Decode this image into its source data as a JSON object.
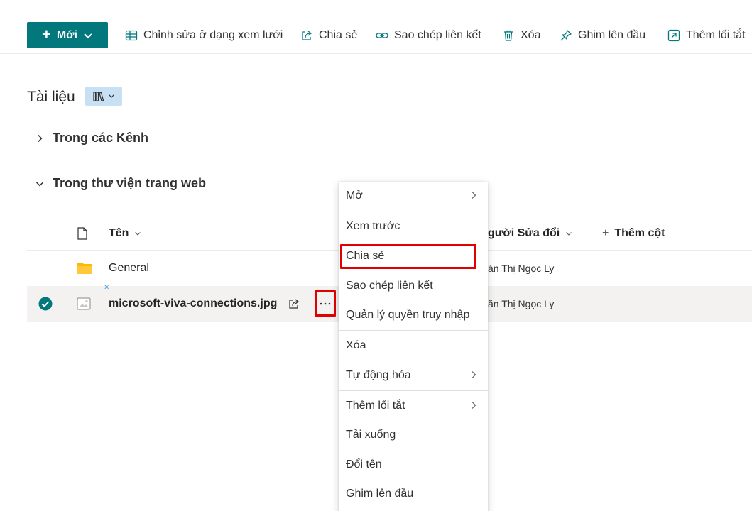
{
  "toolbar": {
    "new_label": "Mới",
    "grid_edit_label": "Chỉnh sửa ở dạng xem lưới",
    "share_label": "Chia sẻ",
    "copy_link_label": "Sao chép liên kết",
    "delete_label": "Xóa",
    "pin_label": "Ghim lên đầu",
    "shortcut_label": "Thêm lối tắt"
  },
  "library": {
    "title": "Tài liệu",
    "groups": [
      {
        "label": "Trong các Kênh",
        "expanded": false
      },
      {
        "label": "Trong thư viện trang web",
        "expanded": true
      }
    ]
  },
  "list": {
    "columns": {
      "name": "Tên",
      "modified_by": "gười Sửa đổi",
      "add_column": "Thêm cột"
    },
    "rows": [
      {
        "name": "General",
        "type": "folder",
        "modified_by": "ăn Thị Ngọc Ly",
        "selected": false
      },
      {
        "name": "microsoft-viva-connections.jpg",
        "type": "image",
        "modified_by": "ăn Thị Ngọc Ly",
        "selected": true
      }
    ]
  },
  "context_menu": {
    "items": [
      {
        "label": "Mở",
        "submenu": true
      },
      {
        "label": "Xem trước",
        "submenu": false
      },
      {
        "label": "Chia sẻ",
        "submenu": false,
        "highlighted": true
      },
      {
        "label": "Sao chép liên kết",
        "submenu": false
      },
      {
        "label": "Quản lý quyền truy nhập",
        "submenu": false
      },
      {
        "label": "Xóa",
        "submenu": false
      },
      {
        "label": "Tự động hóa",
        "submenu": true
      },
      {
        "label": "Thêm lối tắt",
        "submenu": true
      },
      {
        "label": "Tải xuống",
        "submenu": false
      },
      {
        "label": "Đổi tên",
        "submenu": false
      },
      {
        "label": "Ghim lên đầu",
        "submenu": false
      }
    ]
  },
  "colors": {
    "accent": "#03787c",
    "highlight": "#e00000",
    "folder": "#ffb900",
    "selected_row": "#f3f2f1",
    "check": "#03787c"
  }
}
